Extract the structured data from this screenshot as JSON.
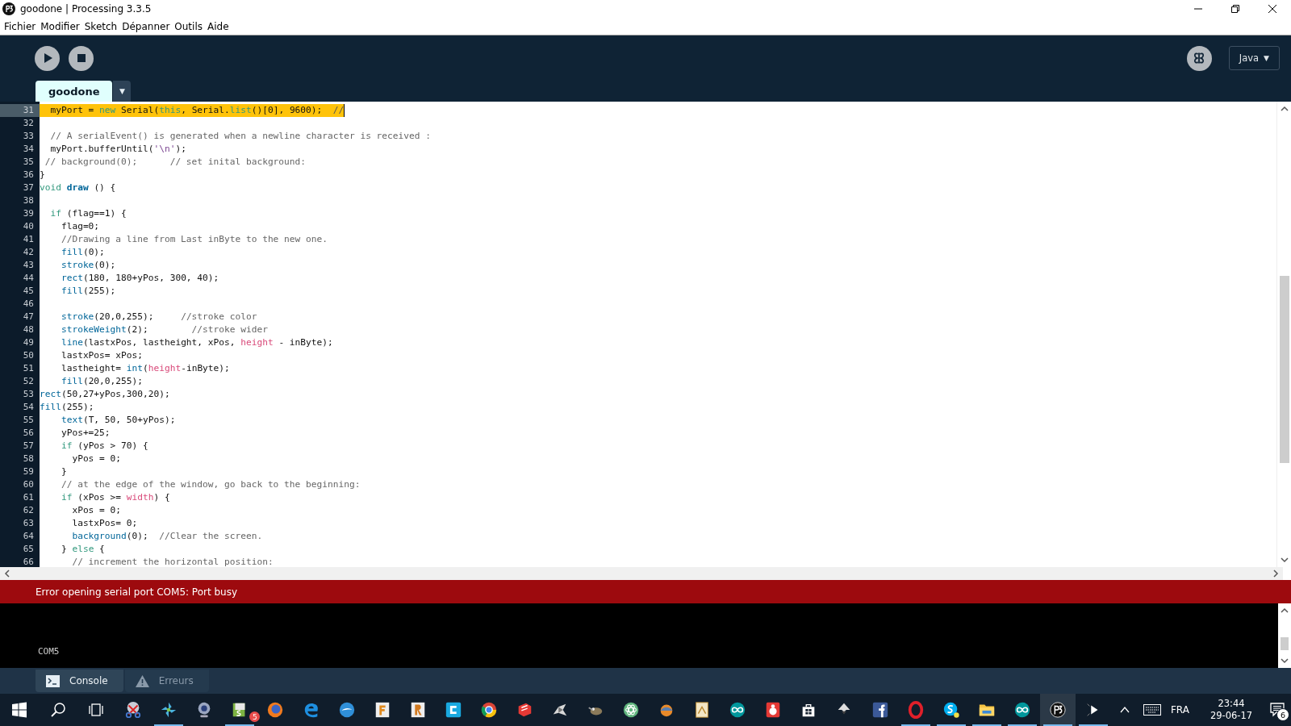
{
  "window": {
    "title": "goodone | Processing 3.3.5"
  },
  "menu": [
    "Fichier",
    "Modifier",
    "Sketch",
    "Dépanner",
    "Outils",
    "Aide"
  ],
  "toolbar": {
    "mode": {
      "label": "Java",
      "caret": "▼"
    }
  },
  "tabs": [
    {
      "label": "goodone",
      "selected": true
    }
  ],
  "tab_menu": "▼",
  "editor": {
    "lines": [
      {
        "number": "31",
        "highlighted": true,
        "tokens": [
          {
            "kind": "plain",
            "text": "  myPort = "
          },
          {
            "kind": "keyword",
            "text": "new"
          },
          {
            "kind": "plain",
            "text": " Serial("
          },
          {
            "kind": "keyword",
            "text": "this"
          },
          {
            "kind": "plain",
            "text": ", Serial."
          },
          {
            "kind": "keyword",
            "text": "list"
          },
          {
            "kind": "plain",
            "text": "()[0], 9600);  "
          },
          {
            "kind": "comment",
            "text": "//"
          }
        ]
      },
      {
        "number": "32",
        "highlighted": false
      },
      {
        "number": "33",
        "highlighted": false,
        "tokens": [
          {
            "kind": "comment",
            "text": "  // A serialEvent() is generated when a newline character is received :"
          }
        ]
      },
      {
        "number": "34",
        "highlighted": false,
        "tokens": [
          {
            "kind": "plain",
            "text": "  myPort.bufferUntil("
          },
          {
            "kind": "string",
            "text": "'\\n'"
          },
          {
            "kind": "plain",
            "text": ");"
          }
        ]
      },
      {
        "number": "35",
        "highlighted": false,
        "tokens": [
          {
            "kind": "comment",
            "text": " // background(0);      // set inital background:"
          }
        ]
      },
      {
        "number": "36",
        "highlighted": false,
        "tokens": [
          {
            "kind": "plain",
            "text": "}"
          }
        ]
      },
      {
        "number": "37",
        "highlighted": false,
        "tokens": [
          {
            "kind": "keyword",
            "text": "void"
          },
          {
            "kind": "bold_function",
            "text": " draw"
          },
          {
            "kind": "plain",
            "text": " () {"
          }
        ]
      },
      {
        "number": "38",
        "highlighted": false
      },
      {
        "number": "39",
        "highlighted": false,
        "tokens": [
          {
            "kind": "keyword",
            "text": "  if"
          },
          {
            "kind": "plain",
            "text": " (flag==1) {"
          }
        ]
      },
      {
        "number": "40",
        "highlighted": false,
        "tokens": [
          {
            "kind": "plain",
            "text": "    flag=0;"
          }
        ]
      },
      {
        "number": "41",
        "highlighted": false,
        "tokens": [
          {
            "kind": "comment",
            "text": "    //Drawing a line from Last inByte to the new one."
          }
        ]
      },
      {
        "number": "42",
        "highlighted": false,
        "tokens": [
          {
            "kind": "function",
            "text": "    fill"
          },
          {
            "kind": "plain",
            "text": "(0);"
          }
        ]
      },
      {
        "number": "43",
        "highlighted": false,
        "tokens": [
          {
            "kind": "function",
            "text": "    stroke"
          },
          {
            "kind": "plain",
            "text": "(0);"
          }
        ]
      },
      {
        "number": "44",
        "highlighted": false,
        "tokens": [
          {
            "kind": "function",
            "text": "    rect"
          },
          {
            "kind": "plain",
            "text": "(180, 180+yPos, 300, 40);"
          }
        ]
      },
      {
        "number": "45",
        "highlighted": false,
        "tokens": [
          {
            "kind": "function",
            "text": "    fill"
          },
          {
            "kind": "plain",
            "text": "(255);"
          }
        ]
      },
      {
        "number": "46",
        "highlighted": false
      },
      {
        "number": "47",
        "highlighted": false,
        "tokens": [
          {
            "kind": "function",
            "text": "    stroke"
          },
          {
            "kind": "plain",
            "text": "(20,0,255);     "
          },
          {
            "kind": "comment",
            "text": "//stroke color"
          }
        ]
      },
      {
        "number": "48",
        "highlighted": false,
        "tokens": [
          {
            "kind": "function",
            "text": "    strokeWeight"
          },
          {
            "kind": "plain",
            "text": "(2);        "
          },
          {
            "kind": "comment",
            "text": "//stroke wider"
          }
        ]
      },
      {
        "number": "49",
        "highlighted": false,
        "tokens": [
          {
            "kind": "function",
            "text": "    line"
          },
          {
            "kind": "plain",
            "text": "(lastxPos, lastheight, xPos, "
          },
          {
            "kind": "constant",
            "text": "height"
          },
          {
            "kind": "plain",
            "text": " - inByte);"
          }
        ]
      },
      {
        "number": "50",
        "highlighted": false,
        "tokens": [
          {
            "kind": "plain",
            "text": "    lastxPos= xPos;"
          }
        ]
      },
      {
        "number": "51",
        "highlighted": false,
        "tokens": [
          {
            "kind": "plain",
            "text": "    lastheight= "
          },
          {
            "kind": "function",
            "text": "int"
          },
          {
            "kind": "plain",
            "text": "("
          },
          {
            "kind": "constant",
            "text": "height"
          },
          {
            "kind": "plain",
            "text": "-inByte);"
          }
        ]
      },
      {
        "number": "52",
        "highlighted": false,
        "tokens": [
          {
            "kind": "function",
            "text": "    fill"
          },
          {
            "kind": "plain",
            "text": "(20,0,255);"
          }
        ]
      },
      {
        "number": "53",
        "highlighted": false,
        "tokens": [
          {
            "kind": "function",
            "text": "rect"
          },
          {
            "kind": "plain",
            "text": "(50,27+yPos,300,20);"
          }
        ]
      },
      {
        "number": "54",
        "highlighted": false,
        "tokens": [
          {
            "kind": "function",
            "text": "fill"
          },
          {
            "kind": "plain",
            "text": "(255);"
          }
        ]
      },
      {
        "number": "55",
        "highlighted": false,
        "tokens": [
          {
            "kind": "function",
            "text": "    text"
          },
          {
            "kind": "plain",
            "text": "(T, 50, 50+yPos);"
          }
        ]
      },
      {
        "number": "56",
        "highlighted": false,
        "tokens": [
          {
            "kind": "plain",
            "text": "    yPos+=25;"
          }
        ]
      },
      {
        "number": "57",
        "highlighted": false,
        "tokens": [
          {
            "kind": "keyword",
            "text": "    if"
          },
          {
            "kind": "plain",
            "text": " (yPos > 70) {"
          }
        ]
      },
      {
        "number": "58",
        "highlighted": false,
        "tokens": [
          {
            "kind": "plain",
            "text": "      yPos = 0;"
          }
        ]
      },
      {
        "number": "59",
        "highlighted": false,
        "tokens": [
          {
            "kind": "plain",
            "text": "    }"
          }
        ]
      },
      {
        "number": "60",
        "highlighted": false,
        "tokens": [
          {
            "kind": "comment",
            "text": "    // at the edge of the window, go back to the beginning:"
          }
        ]
      },
      {
        "number": "61",
        "highlighted": false,
        "tokens": [
          {
            "kind": "keyword",
            "text": "    if"
          },
          {
            "kind": "plain",
            "text": " (xPos >= "
          },
          {
            "kind": "constant",
            "text": "width"
          },
          {
            "kind": "plain",
            "text": ") {"
          }
        ]
      },
      {
        "number": "62",
        "highlighted": false,
        "tokens": [
          {
            "kind": "plain",
            "text": "      xPos = 0;"
          }
        ]
      },
      {
        "number": "63",
        "highlighted": false,
        "tokens": [
          {
            "kind": "plain",
            "text": "      lastxPos= 0;"
          }
        ]
      },
      {
        "number": "64",
        "highlighted": false,
        "tokens": [
          {
            "kind": "function",
            "text": "      background"
          },
          {
            "kind": "plain",
            "text": "(0);  "
          },
          {
            "kind": "comment",
            "text": "//Clear the screen."
          }
        ]
      },
      {
        "number": "65",
        "highlighted": false,
        "tokens": [
          {
            "kind": "plain",
            "text": "    } "
          },
          {
            "kind": "keyword",
            "text": "else"
          },
          {
            "kind": "plain",
            "text": " {"
          }
        ]
      },
      {
        "number": "66",
        "highlighted": false,
        "tokens": [
          {
            "kind": "comment",
            "text": "      // increment the horizontal position:"
          }
        ]
      }
    ]
  },
  "error_bar": {
    "message": "Error opening serial port COM5: Port busy"
  },
  "console": {
    "lines": [
      "COM5"
    ]
  },
  "console_tabs": [
    {
      "label": "Console",
      "kind": "console",
      "selected": true
    },
    {
      "label": "Erreurs",
      "kind": "errors",
      "selected": false
    }
  ],
  "taskbar": {
    "apps": [
      {
        "kind": "scissors",
        "running": false,
        "active": false
      },
      {
        "kind": "pinwheel",
        "running": true,
        "active": false
      },
      {
        "kind": "webcam",
        "running": false,
        "active": false
      },
      {
        "kind": "slides",
        "running": true,
        "active": false,
        "badge": "5"
      },
      {
        "kind": "fox",
        "running": false,
        "active": false
      },
      {
        "kind": "edge",
        "running": false,
        "active": false
      },
      {
        "kind": "bird",
        "running": false,
        "active": false
      },
      {
        "kind": "tile_f",
        "running": false,
        "active": false
      },
      {
        "kind": "tile_r",
        "running": false,
        "active": false
      },
      {
        "kind": "tile_c",
        "running": false,
        "active": false
      },
      {
        "kind": "wheel",
        "running": false,
        "active": false
      },
      {
        "kind": "red_cube",
        "running": false,
        "active": false
      },
      {
        "kind": "horn",
        "running": false,
        "active": false
      },
      {
        "kind": "creature",
        "running": false,
        "active": false
      },
      {
        "kind": "atom",
        "running": false,
        "active": false
      },
      {
        "kind": "sphere",
        "running": false,
        "active": false
      },
      {
        "kind": "document",
        "running": false,
        "active": false
      },
      {
        "kind": "infinity",
        "running": false,
        "active": false
      },
      {
        "kind": "ladybug",
        "running": false,
        "active": false
      },
      {
        "kind": "bag",
        "running": false,
        "active": false
      },
      {
        "kind": "ink",
        "running": false,
        "active": false
      },
      {
        "kind": "letter_f",
        "running": false,
        "active": false
      },
      {
        "kind": "ring",
        "running": true,
        "active": false
      },
      {
        "kind": "letter_s",
        "running": true,
        "active": false
      },
      {
        "kind": "folder",
        "running": true,
        "active": false
      },
      {
        "kind": "infinity",
        "running": true,
        "active": false
      },
      {
        "kind": "app_logo",
        "running": true,
        "active": true
      },
      {
        "kind": "play",
        "running": true,
        "active": false
      }
    ],
    "language": "FRA",
    "time": "23:44",
    "date": "29-06-17",
    "notifications": "6"
  }
}
